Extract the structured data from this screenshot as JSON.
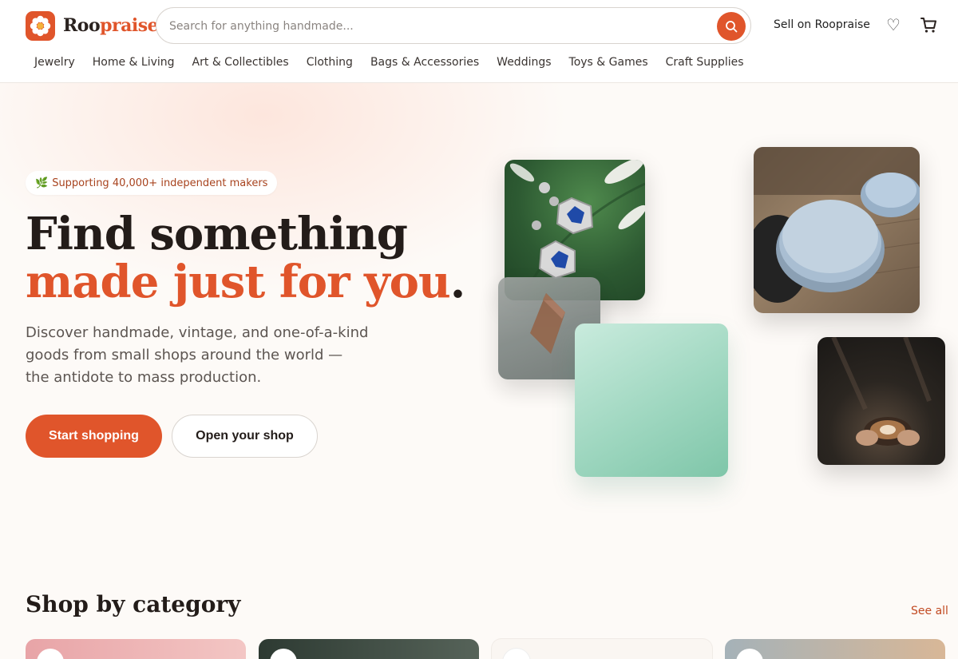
{
  "brand": {
    "name_part1": "Roo",
    "name_part2": "praise",
    "accent_color": "#e0552b"
  },
  "search": {
    "placeholder": "Search for anything handmade...",
    "value": "",
    "icon": "search-icon"
  },
  "header": {
    "sell_label": "Sell on Roopraise",
    "favorites_icon": "heart-icon",
    "cart_icon": "cart-icon"
  },
  "categories_nav": [
    {
      "label": "Jewelry"
    },
    {
      "label": "Home & Living"
    },
    {
      "label": "Art & Collectibles"
    },
    {
      "label": "Clothing"
    },
    {
      "label": "Bags & Accessories"
    },
    {
      "label": "Weddings"
    },
    {
      "label": "Toys & Games"
    },
    {
      "label": "Craft Supplies"
    }
  ],
  "hero": {
    "badge_icon": "🌿",
    "badge_text": "Supporting 40,000+ independent makers",
    "headline_part1": "Find something ",
    "headline_highlight": "made just for you",
    "headline_end": ".",
    "subcopy": "Discover handmade, vintage, and one-of-a-kind goods from small shops around the world — the antidote to mass production.",
    "primary_cta": "Start shopping",
    "secondary_cta": "Open your shop"
  },
  "category_section": {
    "title": "Shop by category",
    "see_all": "See all"
  }
}
